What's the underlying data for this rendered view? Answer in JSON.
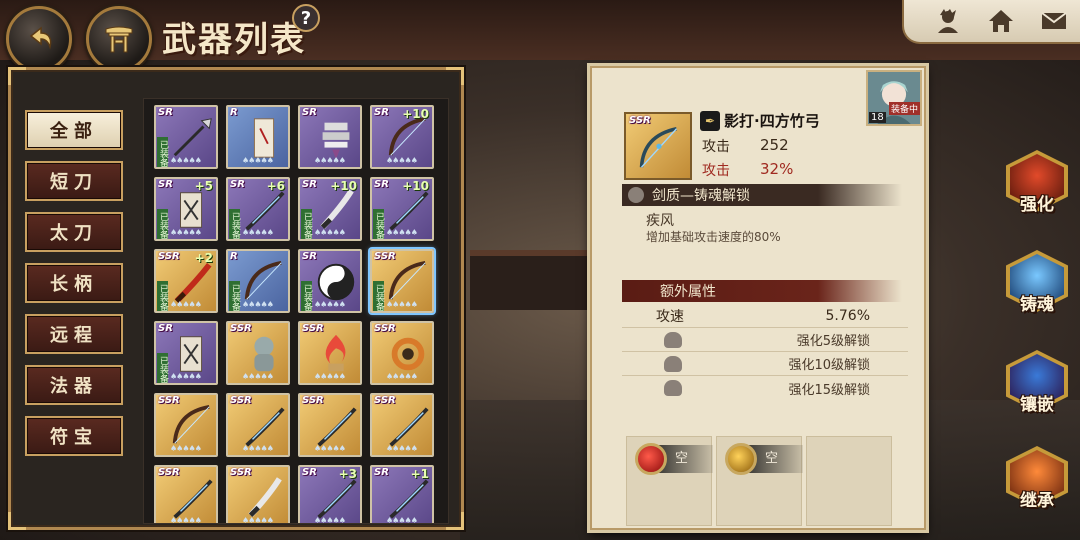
{
  "header": {
    "title": "武器列表",
    "help": "?"
  },
  "topbar": {
    "icons": [
      "character-icon",
      "home-icon",
      "mail-icon"
    ]
  },
  "categories": [
    {
      "label": "全部",
      "active": true
    },
    {
      "label": "短刀"
    },
    {
      "label": "太刀"
    },
    {
      "label": "长柄"
    },
    {
      "label": "远程"
    },
    {
      "label": "法器"
    },
    {
      "label": "符宝"
    }
  ],
  "weapons": [
    {
      "rarity": "SR",
      "plus": "",
      "equipped": "已装备",
      "art": "spear"
    },
    {
      "rarity": "R",
      "plus": "",
      "equipped": "",
      "art": "scroll"
    },
    {
      "rarity": "SR",
      "plus": "",
      "equipped": "",
      "art": "bell"
    },
    {
      "rarity": "SR",
      "plus": "+10",
      "equipped": "",
      "art": "bow"
    },
    {
      "rarity": "SR",
      "plus": "+5",
      "equipped": "已装备",
      "art": "talisman"
    },
    {
      "rarity": "SR",
      "plus": "+6",
      "equipped": "已装备",
      "art": "katana"
    },
    {
      "rarity": "SR",
      "plus": "+10",
      "equipped": "已装备",
      "art": "blade"
    },
    {
      "rarity": "SR",
      "plus": "+10",
      "equipped": "已装备",
      "art": "katana"
    },
    {
      "rarity": "SSR",
      "plus": "+2",
      "equipped": "已装备",
      "art": "redblade"
    },
    {
      "rarity": "R",
      "plus": "",
      "equipped": "已装备",
      "art": "bow"
    },
    {
      "rarity": "SR",
      "plus": "",
      "equipped": "已装备",
      "art": "taiji"
    },
    {
      "rarity": "SSR",
      "plus": "",
      "equipped": "已装备",
      "art": "bow",
      "selected": true
    },
    {
      "rarity": "SR",
      "plus": "",
      "equipped": "已装备",
      "art": "talisman"
    },
    {
      "rarity": "SSR",
      "plus": "",
      "equipped": "",
      "art": "statue"
    },
    {
      "rarity": "SSR",
      "plus": "",
      "equipped": "",
      "art": "flame"
    },
    {
      "rarity": "SSR",
      "plus": "",
      "equipped": "",
      "art": "ring"
    },
    {
      "rarity": "SSR",
      "plus": "",
      "equipped": "",
      "art": "bow"
    },
    {
      "rarity": "SSR",
      "plus": "",
      "equipped": "",
      "art": "katana"
    },
    {
      "rarity": "SSR",
      "plus": "",
      "equipped": "",
      "art": "katana"
    },
    {
      "rarity": "SSR",
      "plus": "",
      "equipped": "",
      "art": "katana"
    },
    {
      "rarity": "SSR",
      "plus": "",
      "equipped": "",
      "art": "katana"
    },
    {
      "rarity": "SSR",
      "plus": "",
      "equipped": "",
      "art": "blade"
    },
    {
      "rarity": "SR",
      "plus": "+3",
      "equipped": "",
      "art": "katana"
    },
    {
      "rarity": "SR",
      "plus": "+1",
      "equipped": "",
      "art": "katana"
    }
  ],
  "detail": {
    "rarity": "SSR",
    "name": "影打·四方竹弓",
    "attack_label": "攻击",
    "attack_value": "252",
    "attack2_label": "攻击",
    "attack2_value": "32%",
    "avatar_level": "18",
    "avatar_tag": "装备中",
    "soul_section": "剑质—铸魂解锁",
    "soul_name": "疾风",
    "soul_desc": "增加基础攻击速度的80%",
    "extra_section": "额外属性",
    "extra_attr_label": "攻速",
    "extra_attr_value": "5.76%",
    "locks": [
      "强化5级解锁",
      "强化10级解锁",
      "强化15级解锁"
    ],
    "gems": [
      {
        "label": "空",
        "color": "#c81e1e"
      },
      {
        "label": "空",
        "color": "#d49a1e"
      }
    ]
  },
  "actions": [
    {
      "label": "强化",
      "color": "#8a2a14"
    },
    {
      "label": "铸魂",
      "color": "#1e5a8a"
    },
    {
      "label": "镶嵌",
      "color": "#4a2a6a"
    },
    {
      "label": "继承",
      "color": "#8a3a10"
    }
  ]
}
